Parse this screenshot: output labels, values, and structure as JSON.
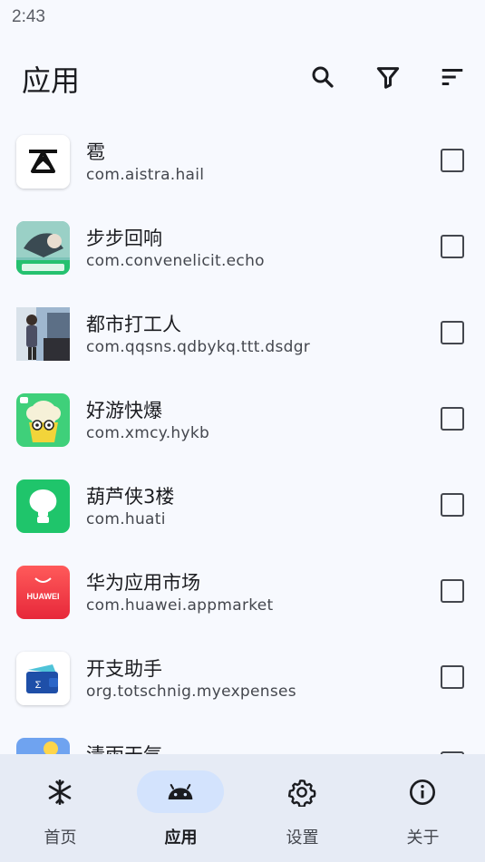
{
  "status_bar": {
    "time": "2:43"
  },
  "app_bar": {
    "title": "应用",
    "actions": [
      {
        "icon": "search-icon"
      },
      {
        "icon": "filter-icon"
      },
      {
        "icon": "sort-icon"
      }
    ]
  },
  "apps": [
    {
      "name": "雹",
      "package": "com.aistra.hail",
      "icon": "hail-icon",
      "checked": false
    },
    {
      "name": "步步回响",
      "package": "com.convenelicit.echo",
      "icon": "echo-app-icon",
      "checked": false
    },
    {
      "name": "都市打工人",
      "package": "com.qqsns.qdbykq.ttt.dsdgr",
      "icon": "city-worker-app-icon",
      "checked": false
    },
    {
      "name": "好游快爆",
      "package": "com.xmcy.hykb",
      "icon": "hykb-app-icon",
      "checked": false
    },
    {
      "name": "葫芦侠3楼",
      "package": "com.huati",
      "icon": "huluxia-app-icon",
      "checked": false
    },
    {
      "name": "华为应用市场",
      "package": "com.huawei.appmarket",
      "icon": "huawei-appmarket-icon",
      "icon_text": "HUAWEI",
      "checked": false
    },
    {
      "name": "开支助手",
      "package": "org.totschnig.myexpenses",
      "icon": "wallet-app-icon",
      "checked": false
    },
    {
      "name": "清雨天气",
      "package": "",
      "icon": "weather-app-icon",
      "checked": false
    }
  ],
  "bottom_nav": [
    {
      "label": "首页",
      "icon": "snowflake-icon",
      "active": false
    },
    {
      "label": "应用",
      "icon": "android-icon",
      "active": true
    },
    {
      "label": "设置",
      "icon": "gear-icon",
      "active": false
    },
    {
      "label": "关于",
      "icon": "info-icon",
      "active": false
    }
  ],
  "colors": {
    "background": "#f7f9fe",
    "nav_background": "#e6ebf5",
    "active_pill": "#d3e3fd",
    "text_primary": "#1b1c20",
    "text_secondary": "#44474e"
  }
}
